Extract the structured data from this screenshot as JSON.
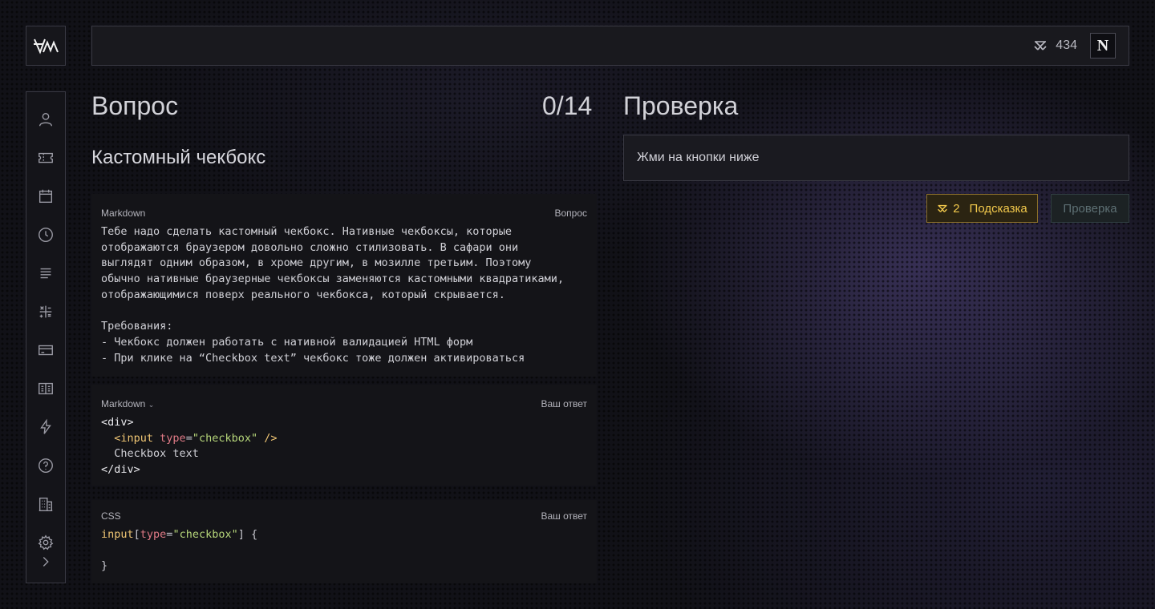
{
  "logo": {
    "icon": "brand-logo-icon"
  },
  "topbar": {
    "coins": "434",
    "coins_icon": "coin-stack-icon",
    "avatar_letter": "N"
  },
  "sidebar": {
    "items": [
      {
        "icon": "user-icon"
      },
      {
        "icon": "ticket-icon"
      },
      {
        "icon": "calendar-icon"
      },
      {
        "icon": "clock-icon"
      },
      {
        "icon": "list-icon"
      },
      {
        "icon": "math-icon"
      },
      {
        "icon": "card-icon"
      },
      {
        "icon": "book-icon"
      },
      {
        "icon": "lightning-icon"
      },
      {
        "icon": "help-icon"
      },
      {
        "icon": "building-icon"
      },
      {
        "icon": "gear-icon"
      }
    ],
    "expand_icon": "chevron-right-icon"
  },
  "question": {
    "heading": "Вопрос",
    "counter": "0/14",
    "task_title": "Кастомный чекбокс",
    "description_block": {
      "lang": "Markdown",
      "role": "Вопрос",
      "lines": [
        "Тебе надо сделать кастомный чекбокс. Нативные чекбоксы, которые",
        "отображаются браузером довольно сложно стилизовать. В сафари они",
        "выглядят одним образом, в хроме другим, в мозилле третьим. Поэтому",
        "обычно нативные браузерные чекбоксы заменяются кастомными квадратиками,",
        "отображающимися поверх реального чекбокса, который скрывается.",
        "",
        "Требования:",
        "- Чекбокс должен работать с нативной валидацией HTML форм",
        "- При клике на “Checkbox text” чекбокс тоже должен активироваться"
      ]
    },
    "html_block": {
      "lang": "Markdown",
      "role": "Ваш ответ",
      "line1": "<div>",
      "line2_indent": "  ",
      "line2_tag": "<input ",
      "line2_attr": "type",
      "line2_eq": "=",
      "line2_str": "\"checkbox\"",
      "line2_close": " />",
      "line3": "  Checkbox text",
      "line4": "</div>"
    },
    "css_block": {
      "lang": "CSS",
      "role": "Ваш ответ",
      "sel_tag": "input",
      "sel_open": "[",
      "sel_attr": "type",
      "sel_eq": "=",
      "sel_str": "\"checkbox\"",
      "sel_close": "] {",
      "line2": "",
      "line3": "}"
    }
  },
  "check": {
    "heading": "Проверка",
    "result_text": "Жми на кнопки ниже",
    "hint_count": "2",
    "hint_label": "Подсказка",
    "check_label": "Проверка"
  },
  "colors": {
    "accent_hint": "#f2c94c",
    "background": "#111117"
  }
}
